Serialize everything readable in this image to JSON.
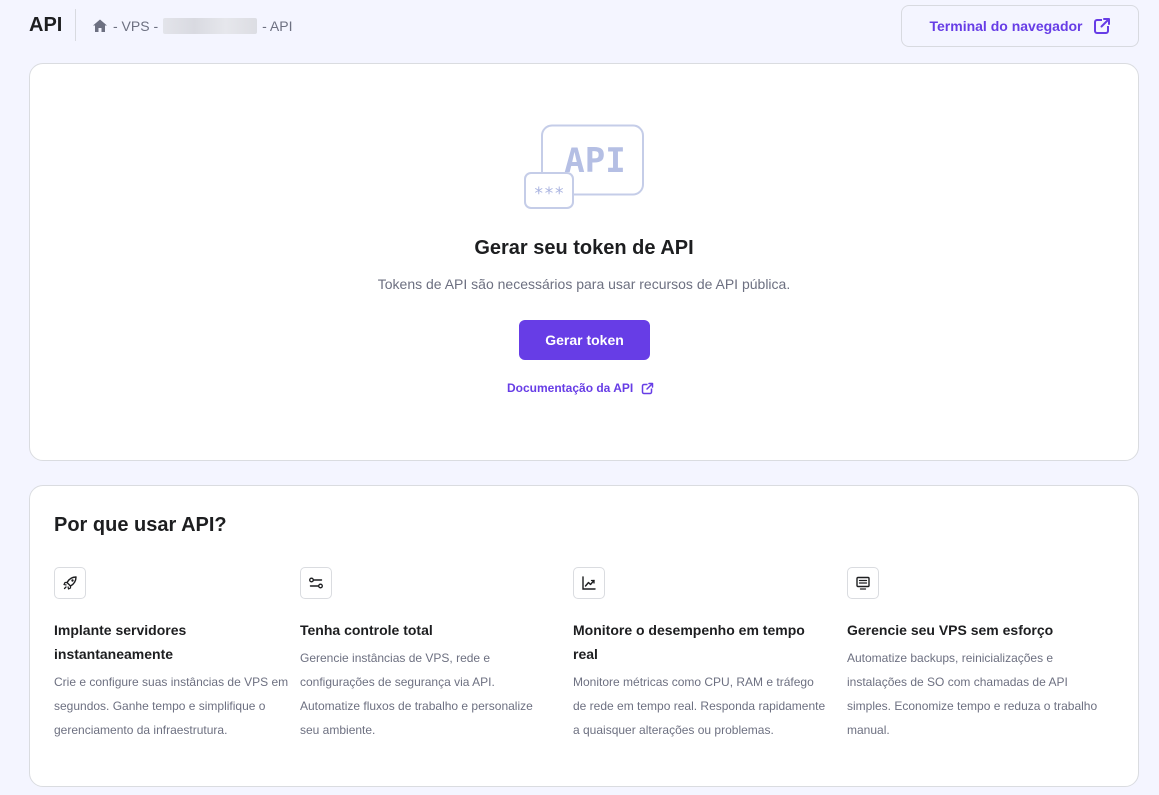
{
  "header": {
    "title": "API",
    "breadcrumb": {
      "sep1": "- VPS -",
      "sep2": "- API"
    },
    "terminal_button": "Terminal do navegador"
  },
  "token_card": {
    "illustration_label": "API",
    "illustration_mask": "***",
    "heading": "Gerar seu token de API",
    "description": "Tokens de API são necessários para usar recursos de API pública.",
    "generate_button": "Gerar token",
    "docs_link": "Documentação da API"
  },
  "why_card": {
    "title": "Por que usar API?",
    "features": [
      {
        "icon": "rocket-icon",
        "title": "Implante servidores instantaneamente",
        "description": "Crie e configure suas instâncias de VPS em segundos. Ganhe tempo e simplifique o gerenciamento da infraestrutura."
      },
      {
        "icon": "route-icon",
        "title": "Tenha controle total",
        "description": "Gerencie instâncias de VPS, rede e configurações de segurança via API. Automatize fluxos de trabalho e personalize seu ambiente."
      },
      {
        "icon": "chart-icon",
        "title": "Monitore o desempenho em tempo real",
        "description": "Monitore métricas como CPU, RAM e tráfego de rede em tempo real. Responda rapidamente a quaisquer alterações ou problemas."
      },
      {
        "icon": "monitor-icon",
        "title": "Gerencie seu VPS sem esforço",
        "description": "Automatize backups, reinicializações e instalações de SO com chamadas de API simples. Economize tempo e reduza o trabalho manual."
      }
    ]
  },
  "colors": {
    "accent": "#673de6",
    "background": "#f4f5ff",
    "text": "#1d1e20",
    "muted": "#6d7081"
  }
}
